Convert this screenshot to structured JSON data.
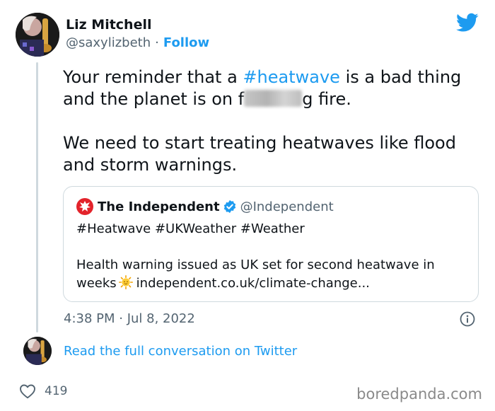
{
  "author": {
    "display_name": "Liz Mitchell",
    "handle": "@saxylizbeth",
    "separator": "·",
    "follow_label": "Follow"
  },
  "tweet": {
    "text_before_hashtag": "Your reminder that a ",
    "hashtag": "#heatwave",
    "text_after_hashtag": " is a bad thing and the planet is on f",
    "text_after_censor": "g fire.",
    "paragraph2": "We need to start treating heatwaves like flood and storm warnings."
  },
  "quote": {
    "name": "The Independent",
    "handle": "@Independent",
    "hashtags": "#Heatwave #UKWeather #Weather",
    "body_line": "Health warning issued as UK set for second heatwave in weeks",
    "link_text": "independent.co.uk/climate-change..."
  },
  "meta": {
    "timestamp": "4:38 PM · Jul 8, 2022"
  },
  "conversation": {
    "link_label": "Read the full conversation on Twitter"
  },
  "engagement": {
    "likes": "419"
  },
  "watermark": "boredpanda.com",
  "colors": {
    "accent": "#1d9bf0",
    "text": "#0f1419",
    "secondary": "#536471",
    "border": "#cfd9de",
    "independent_red": "#e3232b"
  }
}
